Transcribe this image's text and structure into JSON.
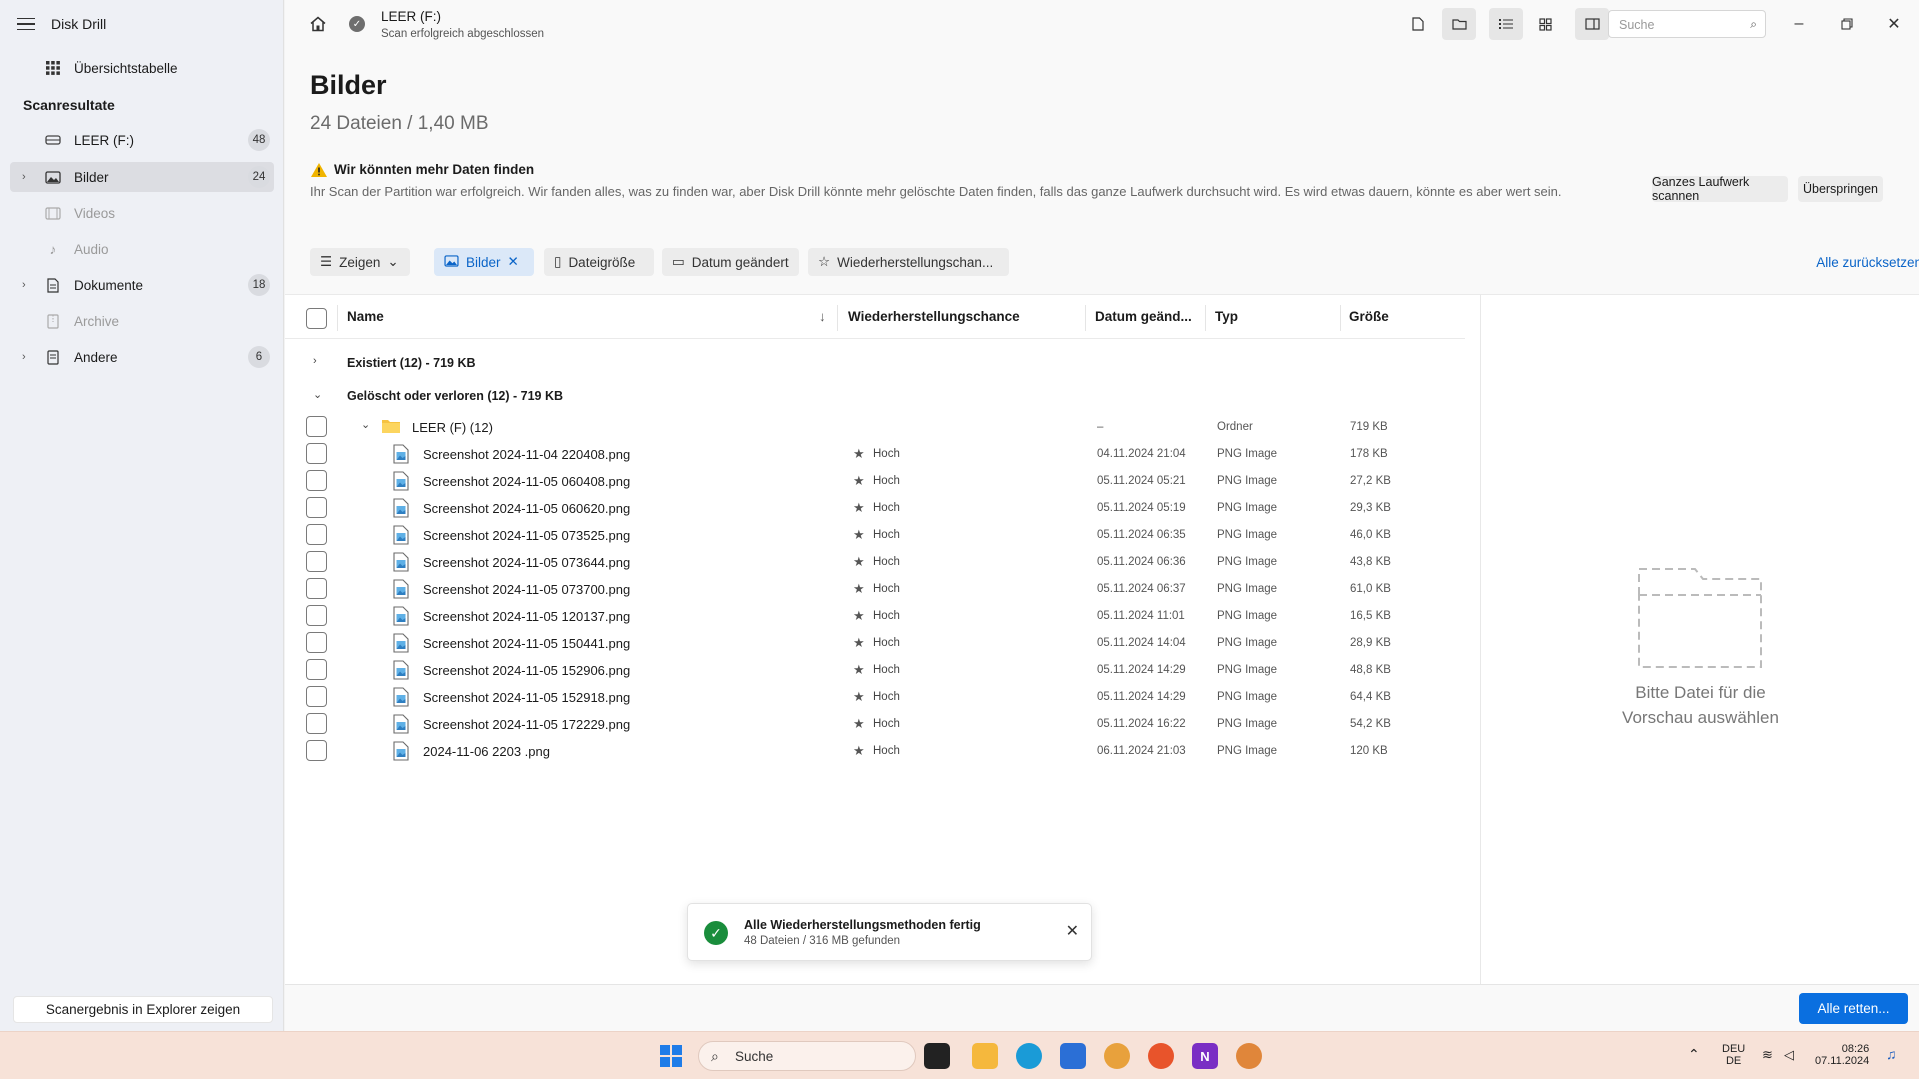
{
  "app": {
    "title": "Disk Drill"
  },
  "sidebar": {
    "overview": "Übersichtstabelle",
    "section": "Scanresultate",
    "items": [
      {
        "label": "LEER (F:)",
        "badge": "48"
      },
      {
        "label": "Bilder",
        "badge": "24"
      },
      {
        "label": "Videos",
        "badge": ""
      },
      {
        "label": "Audio",
        "badge": ""
      },
      {
        "label": "Dokumente",
        "badge": "18"
      },
      {
        "label": "Archive",
        "badge": ""
      },
      {
        "label": "Andere",
        "badge": "6"
      }
    ],
    "explorer_button": "Scanergebnis in Explorer zeigen"
  },
  "topbar": {
    "drive_name": "LEER (F:)",
    "drive_status": "Scan erfolgreich abgeschlossen",
    "search_placeholder": "Suche"
  },
  "page": {
    "title": "Bilder",
    "subtitle": "24 Dateien / 1,40 MB"
  },
  "notice": {
    "title": "Wir könnten mehr Daten finden",
    "text": "Ihr Scan der Partition war erfolgreich. Wir fanden alles, was zu finden war, aber Disk Drill könnte mehr gelöschte Daten finden, falls das ganze Laufwerk durchsucht wird. Es wird etwas dauern, könnte es aber wert sein.",
    "scan_button": "Ganzes Laufwerk scannen",
    "skip_button": "Überspringen"
  },
  "filters": {
    "show": "Zeigen",
    "images": "Bilder",
    "filesize": "Dateigröße",
    "date_changed": "Datum geändert",
    "recovery_chance": "Wiederherstellungschan...",
    "reset_all": "Alle zurücksetzen"
  },
  "table": {
    "headers": {
      "name": "Name",
      "chance": "Wiederherstellungschance",
      "date": "Datum geänd...",
      "type": "Typ",
      "size": "Größe"
    },
    "group_existing": "Existiert (12) - 719 KB",
    "group_deleted": "Gelöscht oder verloren (12) - 719 KB",
    "folder": {
      "name": "LEER (F) (12)",
      "date": "–",
      "type": "Ordner",
      "size": "719 KB"
    },
    "rows": [
      {
        "name": "Screenshot 2024-11-04 220408.png",
        "chance": "Hoch",
        "date": "04.11.2024 21:04",
        "type": "PNG Image",
        "size": "178 KB"
      },
      {
        "name": "Screenshot 2024-11-05 060408.png",
        "chance": "Hoch",
        "date": "05.11.2024 05:21",
        "type": "PNG Image",
        "size": "27,2 KB"
      },
      {
        "name": "Screenshot 2024-11-05 060620.png",
        "chance": "Hoch",
        "date": "05.11.2024 05:19",
        "type": "PNG Image",
        "size": "29,3 KB"
      },
      {
        "name": "Screenshot 2024-11-05 073525.png",
        "chance": "Hoch",
        "date": "05.11.2024 06:35",
        "type": "PNG Image",
        "size": "46,0 KB"
      },
      {
        "name": "Screenshot 2024-11-05 073644.png",
        "chance": "Hoch",
        "date": "05.11.2024 06:36",
        "type": "PNG Image",
        "size": "43,8 KB"
      },
      {
        "name": "Screenshot 2024-11-05 073700.png",
        "chance": "Hoch",
        "date": "05.11.2024 06:37",
        "type": "PNG Image",
        "size": "61,0 KB"
      },
      {
        "name": "Screenshot 2024-11-05 120137.png",
        "chance": "Hoch",
        "date": "05.11.2024 11:01",
        "type": "PNG Image",
        "size": "16,5 KB"
      },
      {
        "name": "Screenshot 2024-11-05 150441.png",
        "chance": "Hoch",
        "date": "05.11.2024 14:04",
        "type": "PNG Image",
        "size": "28,9 KB"
      },
      {
        "name": "Screenshot 2024-11-05 152906.png",
        "chance": "Hoch",
        "date": "05.11.2024 14:29",
        "type": "PNG Image",
        "size": "48,8 KB"
      },
      {
        "name": "Screenshot 2024-11-05 152918.png",
        "chance": "Hoch",
        "date": "05.11.2024 14:29",
        "type": "PNG Image",
        "size": "64,4 KB"
      },
      {
        "name": "Screenshot 2024-11-05 172229.png",
        "chance": "Hoch",
        "date": "05.11.2024 16:22",
        "type": "PNG Image",
        "size": "54,2 KB"
      },
      {
        "name": "2024-11-06 2203 .png",
        "chance": "Hoch",
        "date": "06.11.2024 21:03",
        "type": "PNG Image",
        "size": "120 KB"
      }
    ]
  },
  "preview": {
    "placeholder_line1": "Bitte Datei für die",
    "placeholder_line2": "Vorschau auswählen"
  },
  "toast": {
    "title": "Alle Wiederherstellungsmethoden fertig",
    "text": "48 Dateien / 316 MB gefunden"
  },
  "footer": {
    "recover_all": "Alle retten..."
  },
  "taskbar": {
    "search": "Suche",
    "lang_top": "DEU",
    "lang_bottom": "DE",
    "time": "08:26",
    "date": "07.11.2024"
  },
  "colors": {
    "accent": "#0a6fe0",
    "success": "#1a8d3c",
    "warning": "#f0b400"
  }
}
